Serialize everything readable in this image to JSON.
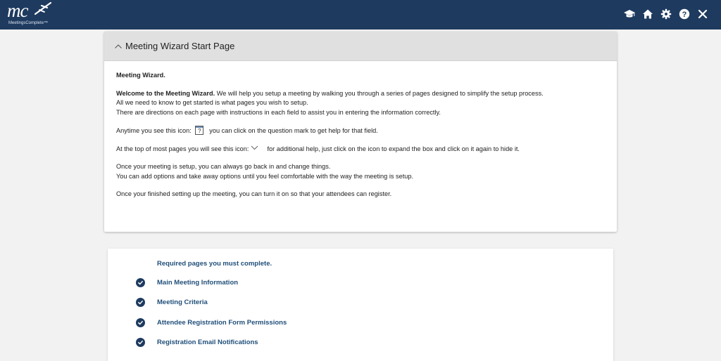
{
  "header": {
    "logo_text": "mc",
    "logo_subtext": "MeetingsComplete™",
    "icons": [
      "graduation-cap-icon",
      "home-icon",
      "gear-icon",
      "help-icon",
      "close-icon"
    ]
  },
  "wizard": {
    "title": "Meeting Wizard Start Page",
    "heading": "Meeting Wizard.",
    "welcome_bold": "Welcome to the Meeting Wizard.",
    "welcome_rest": " We will help you setup a meeting by walking you through a series of pages designed to simplify the setup process.",
    "line2": "All we need to know to get started is what pages you wish to setup.",
    "line3": "There are directions on each page with instructions in each field to assist you in entering the information correctly.",
    "help_icon_before": "Anytime you see this icon:",
    "help_icon_glyph": "?",
    "help_icon_after": "you can click on the question mark to get help for that field.",
    "expand_icon_before": "At the top of most pages you will see this icon:",
    "expand_icon_after": "for additional help, just click on the icon to expand the box and click on it again to hide it.",
    "setup_line1": "Once your meeting is setup, you can always go back in and change things.",
    "setup_line2": "You can add options and take away options until you feel comfortable with the way the meeting is setup.",
    "finished_line": "Once your finished setting up the meeting, you can turn it on so that your attendees can register."
  },
  "required": {
    "heading": "Required pages you must complete.",
    "items": [
      {
        "label": "Main Meeting Information"
      },
      {
        "label": "Meeting Criteria"
      },
      {
        "label": "Attendee Registration Form Permissions"
      },
      {
        "label": "Registration Email Notifications"
      }
    ]
  },
  "colors": {
    "topbar": "#1e3a5f",
    "link": "#1f4e79",
    "card_header": "#e0e0e0",
    "background": "#f2f2f2"
  }
}
